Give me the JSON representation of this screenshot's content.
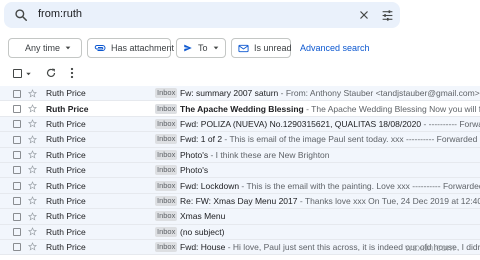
{
  "search": {
    "query": "from:ruth"
  },
  "filters": [
    {
      "label": "Any time",
      "icon": "chevron-down-icon"
    },
    {
      "label": "Has attachment",
      "icon": "attachment-icon"
    },
    {
      "label": "To",
      "icon": "send-icon"
    },
    {
      "label": "Is unread",
      "icon": "mail-icon"
    }
  ],
  "advanced_search_label": "Advanced search",
  "emails": [
    {
      "sender": "Ruth Price",
      "badge": "Inbox",
      "subject": "Fw: summary 2007 saturn",
      "snippet": " - From: Anthony Stauber <tandjstauber@gmail.com> Sent: Wed",
      "unread": false
    },
    {
      "sender": "Ruth Price",
      "badge": "Inbox",
      "subject": "The Apache Wedding Blessing",
      "snippet": " - The Apache Wedding Blessing Now you will feel no storm",
      "unread": true
    },
    {
      "sender": "Ruth Price",
      "badge": "Inbox",
      "subject": "Fwd: POLIZA (NUEVA) No.1290315621, QUALITAS 18/08/2020",
      "snippet": " - ---------- Forwarded message",
      "unread": false
    },
    {
      "sender": "Ruth Price",
      "badge": "Inbox",
      "subject": "Fwd: 1 of 2",
      "snippet": " - This is email of the image Paul sent today. xxx ---------- Forwarded messag",
      "unread": false
    },
    {
      "sender": "Ruth Price",
      "badge": "Inbox",
      "subject": "Photo's",
      "snippet": " - I think these are New Brighton",
      "unread": false
    },
    {
      "sender": "Ruth Price",
      "badge": "Inbox",
      "subject": "Photo's",
      "snippet": "",
      "unread": false
    },
    {
      "sender": "Ruth Price",
      "badge": "Inbox",
      "subject": "Fwd: Lockdown",
      "snippet": " - This is the email with the painting. Love xxx ---------- Forwarded messag",
      "unread": false
    },
    {
      "sender": "Ruth Price",
      "badge": "Inbox",
      "subject": "Re: FW: Xmas Day Menu 2017",
      "snippet": " - Thanks love xxx On Tue, 24 Dec 2019 at 12:40, Dan Price",
      "unread": false
    },
    {
      "sender": "Ruth Price",
      "badge": "Inbox",
      "subject": "Xmas Menu",
      "snippet": "",
      "unread": false
    },
    {
      "sender": "Ruth Price",
      "badge": "Inbox",
      "subject": "(no subject)",
      "snippet": "",
      "unread": false
    },
    {
      "sender": "Ruth Price",
      "badge": "Inbox",
      "subject": "Fwd: House",
      "snippet": " - Hi love, Paul just sent this across, it is indeed our old house, I didn't",
      "unread": false
    }
  ],
  "watermark": "wsxdn.com",
  "colors": {
    "accent": "#0b57d0",
    "search_bg": "#eaf1fb",
    "read_row_bg": "#f2f6fc"
  }
}
